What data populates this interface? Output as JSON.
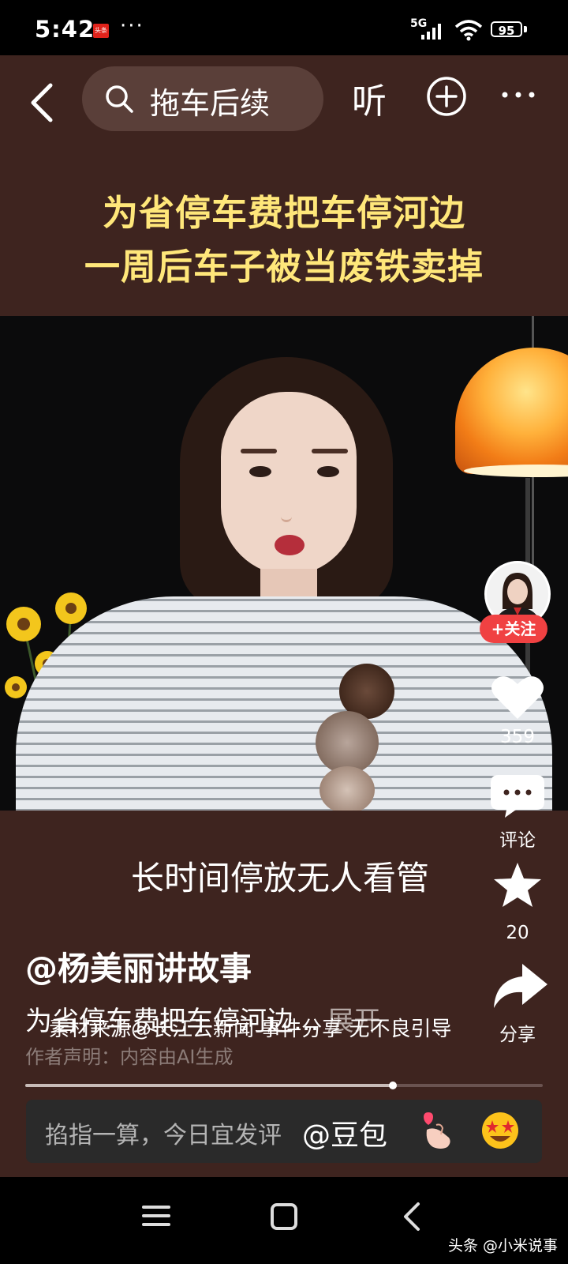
{
  "status": {
    "time": "5:42",
    "app_badge": "头条",
    "more": "···",
    "network": "5G",
    "battery": "95"
  },
  "header": {
    "search_text": "拖车后续",
    "listen_label": "听"
  },
  "headline": {
    "line1": "为省停车费把车停河边",
    "line2": "一周后车子被当废铁卖掉"
  },
  "rail": {
    "follow_label": "+关注",
    "like_count": "359",
    "comment_label": "评论",
    "favorite_count": "20",
    "share_label": "分享"
  },
  "subtitle": "长时间停放无人看管",
  "post": {
    "author": "@杨美丽讲故事",
    "caption": "为省停车费把车停河边...",
    "expand_label": "展开",
    "source": "素材来源@长江云新闻 事件分享 无不良引导",
    "disclaimer": "作者声明：内容由AI生成"
  },
  "progress": {
    "value": 0.71
  },
  "comment_bar": {
    "placeholder": "掐指一算，今日宜发评",
    "mention": "@豆包"
  },
  "icons": [
    "back-icon",
    "search-icon",
    "add-icon",
    "more-icon",
    "heart-icon",
    "comment-icon",
    "star-icon",
    "share-icon",
    "heart-hand-emoji",
    "star-eyes-emoji",
    "nav-menu-icon",
    "nav-home-icon",
    "nav-back-icon"
  ],
  "colors": {
    "app_bg": "#3e241f",
    "headline": "#ffe77a",
    "follow": "#f04142"
  },
  "watermark": "头条 @小米说事"
}
